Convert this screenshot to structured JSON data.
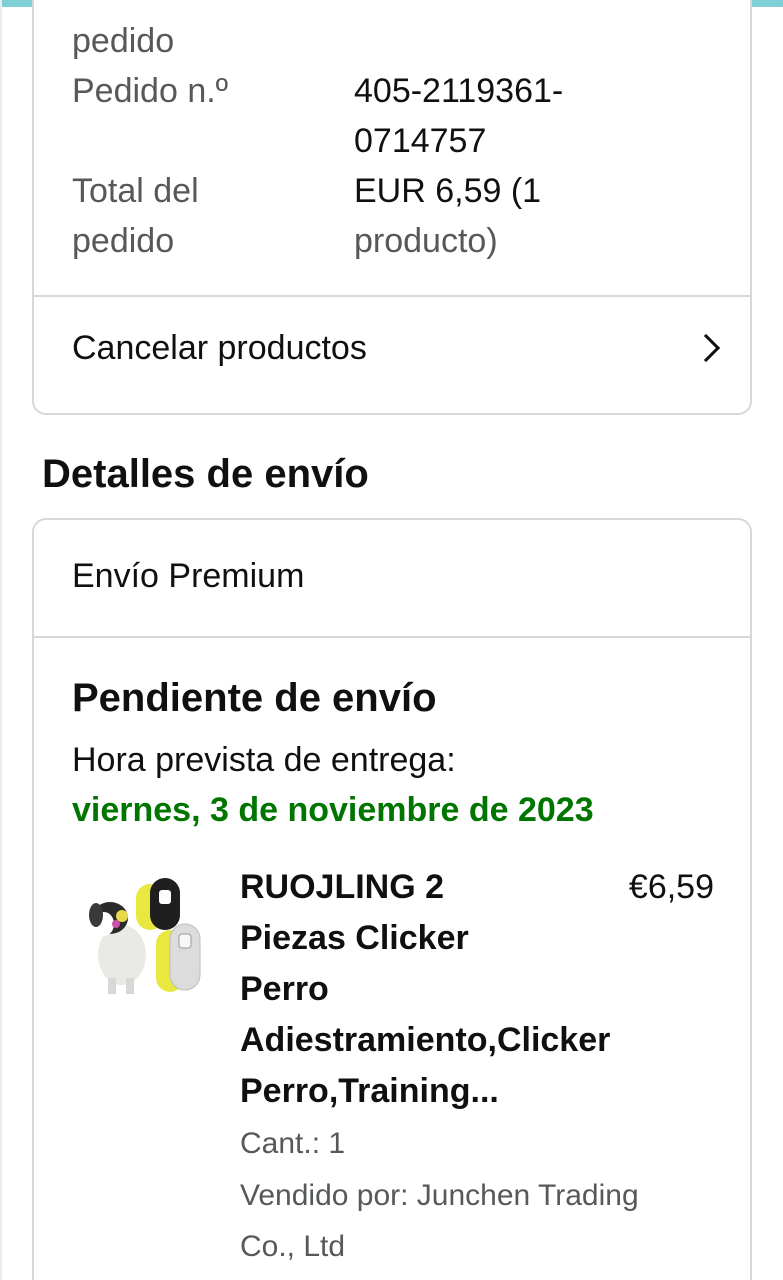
{
  "summary": {
    "partial_label_tail": "pedido",
    "order_number_label": "Pedido n.º",
    "order_number_line1": "405-2119361-",
    "order_number_line2": "0714757",
    "total_label_line1": "Total del",
    "total_label_line2": "pedido",
    "total_value_line1": "EUR 6,59 (1",
    "total_value_line2": "producto)",
    "cancel_label": "Cancelar productos"
  },
  "shipping": {
    "section_title": "Detalles de envío",
    "method": "Envío Premium",
    "status": "Pendiente de envío",
    "eta_label": "Hora prevista de entrega:",
    "eta_date": "viernes, 3 de noviembre de 2023"
  },
  "product": {
    "title_lines": [
      "RUOJLING 2",
      "Piezas Clicker",
      "Perro",
      "Adiestramiento,Clicker",
      "Perro,Training..."
    ],
    "price": "€6,59",
    "quantity": "Cant.: 1",
    "seller_line1": "Vendido por: Junchen Trading",
    "seller_line2": "Co., Ltd"
  },
  "colors": {
    "eta_green": "#007600",
    "border": "#d5d9d9",
    "secondary_text": "#565959"
  },
  "icons": {
    "cancel_row": "chevron-right-icon",
    "product_image": "dog-clicker-thumbnail"
  }
}
